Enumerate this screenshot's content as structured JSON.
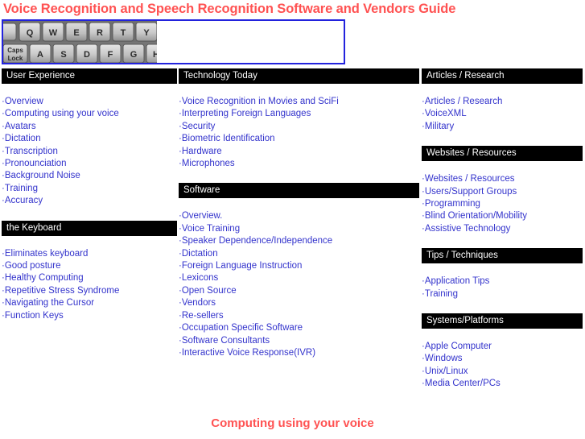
{
  "page": {
    "title": "Voice Recognition and Speech Recognition Software and Vendors Guide",
    "footer_title": "Computing using your voice",
    "title_color": "#ff5252",
    "link_color": "#3333cc",
    "header_bar_color": "#000000",
    "hero_border_color": "#2222dd"
  },
  "hero": {
    "image_alt": "keyboard-photo",
    "keys_row1": [
      "Q",
      "W",
      "E",
      "R",
      "T",
      "Y"
    ],
    "keys_row2": [
      "Caps Lock",
      "A",
      "S",
      "D",
      "F",
      "G",
      "H"
    ]
  },
  "bullet": "·",
  "columns": [
    {
      "name": "column-left",
      "sections": [
        {
          "header": "User Experience",
          "items": [
            "Overview",
            "Computing using your voice",
            "Avatars",
            "Dictation",
            "Transcription",
            "Pronounciation",
            "Background Noise",
            "Training",
            "Accuracy"
          ]
        },
        {
          "header": "the Keyboard",
          "items": [
            "Eliminates keyboard",
            "Good posture",
            "Healthy Computing",
            "Repetitive Stress Syndrome",
            "Navigating the Cursor",
            "Function Keys"
          ]
        }
      ]
    },
    {
      "name": "column-middle",
      "sections": [
        {
          "header": "Technology Today",
          "items": [
            "Voice Recognition in Movies and SciFi",
            "Interpreting Foreign Languages",
            "Security",
            "Biometric Identification",
            "Hardware",
            "Microphones"
          ]
        },
        {
          "header": "Software",
          "items": [
            "Overview.",
            "Voice Training",
            "Speaker Dependence/Independence",
            "Dictation",
            "Foreign Language Instruction",
            "Lexicons",
            "Open Source",
            "Vendors",
            "Re-sellers",
            "Occupation Specific Software",
            "Software Consultants",
            "Interactive Voice Response(IVR)"
          ]
        }
      ]
    },
    {
      "name": "column-right",
      "sections": [
        {
          "header": "Articles / Research",
          "items": [
            "Articles / Research",
            "VoiceXML",
            "Military"
          ]
        },
        {
          "header": "Websites / Resources",
          "items": [
            "Websites / Resources",
            "Users/Support Groups",
            "Programming",
            "Blind Orientation/Mobility",
            "Assistive Technology"
          ]
        },
        {
          "header": "Tips / Techniques",
          "items": [
            "Application Tips",
            "Training"
          ]
        },
        {
          "header": "Systems/Platforms",
          "items": [
            "Apple Computer",
            "Windows",
            "Unix/Linux",
            "Media Center/PCs"
          ]
        }
      ]
    }
  ]
}
